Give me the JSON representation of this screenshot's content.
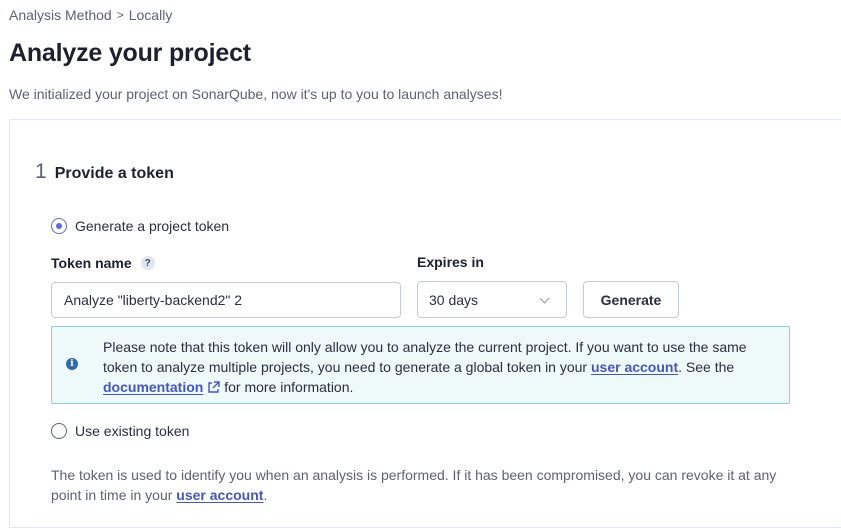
{
  "breadcrumb": {
    "parent": "Analysis Method",
    "separator": ">",
    "current": "Locally"
  },
  "page": {
    "title": "Analyze your project",
    "subtitle": "We initialized your project on SonarQube, now it's up to you to launch analyses!"
  },
  "step": {
    "number": "1",
    "title": "Provide a token"
  },
  "options": {
    "generate_label": "Generate a project token",
    "generate_selected": true,
    "existing_label": "Use existing token",
    "existing_selected": false
  },
  "form": {
    "token_name_label": "Token name",
    "token_name_value": "Analyze \"liberty-backend2\" 2",
    "expires_label": "Expires in",
    "expires_value": "30 days",
    "generate_button": "Generate"
  },
  "info": {
    "text_1": "Please note that this token will only allow you to analyze the current project. If you want to use the same token to analyze multiple projects, you need to generate a global token in your ",
    "link_user_account": "user account",
    "text_2": ". See the ",
    "link_documentation": "documentation",
    "text_3": " for more information."
  },
  "footer": {
    "text_1": "The token is used to identify you when an analysis is performed. If it has been compromised, you can revoke it at any point in time in your ",
    "link_user_account": "user account",
    "text_2": "."
  },
  "colors": {
    "accent": "#5d6cd0",
    "link": "#4656c0",
    "info_border": "#8fcfd6",
    "info_bg": "#eef9fa"
  }
}
